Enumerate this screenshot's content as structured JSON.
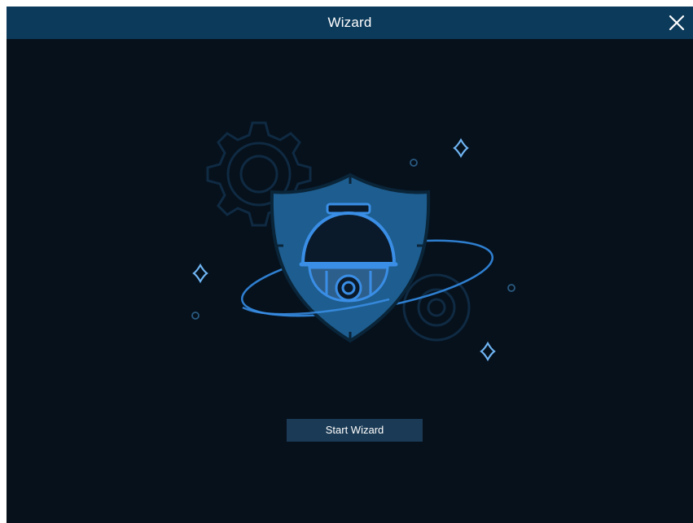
{
  "window": {
    "title": "Wizard",
    "close_icon": "close-icon"
  },
  "illustration": {
    "icon": "shield-dome-camera-icon",
    "accent": "#3a8ee6",
    "shield_color": "#1d5d8f"
  },
  "actions": {
    "start_label": "Start Wizard"
  },
  "colors": {
    "background": "#06111c",
    "titlebar": "#0c3a5b",
    "button": "#1b3a55"
  }
}
